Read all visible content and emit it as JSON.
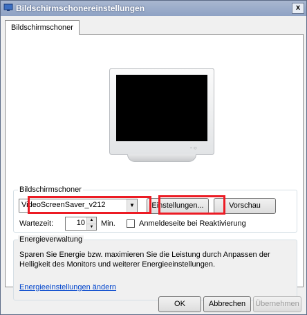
{
  "window": {
    "title": "Bildschirmschonereinstellungen",
    "close_label": "x"
  },
  "tabs": [
    {
      "label": "Bildschirmschoner"
    }
  ],
  "screensaver": {
    "group_label": "Bildschirmschoner",
    "selected": "VideoScreenSaver_v212",
    "settings_button": "Einstellungen...",
    "preview_button": "Vorschau",
    "wait_label": "Wartezeit:",
    "wait_value": "10",
    "unit": "Min.",
    "logon_checkbox_label": "Anmeldeseite bei Reaktivierung",
    "logon_checked": false
  },
  "energy": {
    "group_label": "Energieverwaltung",
    "description": "Sparen Sie Energie bzw. maximieren Sie die Leistung durch Anpassen der Helligkeit des Monitors und weiterer Energieeinstellungen.",
    "link": "Energieeinstellungen ändern"
  },
  "buttons": {
    "ok": "OK",
    "cancel": "Abbrechen",
    "apply": "Übernehmen"
  },
  "colors": {
    "highlight": "#ec1b24",
    "link": "#0044cc"
  }
}
